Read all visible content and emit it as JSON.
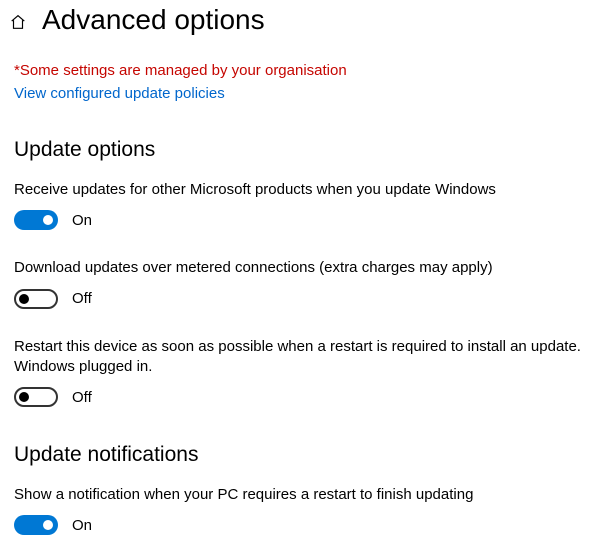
{
  "header": {
    "title": "Advanced options"
  },
  "messages": {
    "managed": "*Some settings are managed by your organisation",
    "view_policies": "View configured update policies"
  },
  "sections": {
    "update_options": {
      "title": "Update options",
      "options": [
        {
          "label": "Receive updates for other Microsoft products when you update Windows",
          "state": "On",
          "on": true
        },
        {
          "label": "Download updates over metered connections (extra charges may apply)",
          "state": "Off",
          "on": false
        },
        {
          "label": "Restart this device as soon as possible when a restart is required to install an update. Windows plugged in.",
          "state": "Off",
          "on": false
        }
      ]
    },
    "update_notifications": {
      "title": "Update notifications",
      "options": [
        {
          "label": "Show a notification when your PC requires a restart to finish updating",
          "state": "On",
          "on": true
        }
      ]
    }
  }
}
